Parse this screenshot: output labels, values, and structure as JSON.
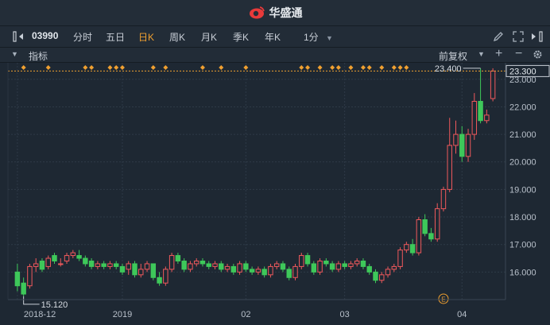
{
  "app": {
    "brand": "华盛通"
  },
  "toolbar": {
    "code": "03990",
    "periods": [
      {
        "label": "分时",
        "active": false
      },
      {
        "label": "五日",
        "active": false
      },
      {
        "label": "日K",
        "active": true
      },
      {
        "label": "周K",
        "active": false
      },
      {
        "label": "月K",
        "active": false
      },
      {
        "label": "季K",
        "active": false
      },
      {
        "label": "年K",
        "active": false
      }
    ],
    "minute": "1分"
  },
  "indicator_bar": {
    "label": "指标",
    "adjust": "前复权"
  },
  "colors": {
    "up": "#f0595c",
    "down": "#3ec85a",
    "accent": "#f0a030",
    "grid": "#2e3a47"
  },
  "chart_data": {
    "type": "candlestick",
    "yticks": [
      "23.000",
      "22.000",
      "21.000",
      "20.000",
      "19.000",
      "18.000",
      "17.000",
      "16.000"
    ],
    "ylim": [
      15.0,
      23.6
    ],
    "xticks": [
      {
        "label": "2018-12",
        "i": 0
      },
      {
        "label": "2019",
        "i": 17
      },
      {
        "label": "02",
        "i": 37
      },
      {
        "label": "03",
        "i": 53
      },
      {
        "label": "04",
        "i": 72
      }
    ],
    "current_price": "23.300",
    "high_label": "23.400",
    "low_label": "15.120",
    "event_marker": "E",
    "event_index": 69,
    "high_index": 75,
    "low_index": 1,
    "dividend_markers": [
      1,
      5,
      11,
      12,
      15,
      16,
      17,
      22,
      24,
      30,
      33,
      37,
      46,
      47,
      49,
      51,
      52,
      54,
      56,
      57,
      59,
      61,
      62,
      63
    ],
    "candles": [
      [
        16.0,
        15.5,
        16.3,
        15.3
      ],
      [
        15.6,
        15.2,
        15.8,
        15.12
      ],
      [
        15.5,
        16.2,
        16.3,
        15.4
      ],
      [
        16.2,
        16.3,
        16.5,
        16.0
      ],
      [
        16.4,
        16.1,
        16.5,
        16.0
      ],
      [
        16.2,
        16.5,
        16.6,
        16.1
      ],
      [
        16.6,
        16.4,
        16.7,
        16.3
      ],
      [
        16.3,
        16.3,
        16.5,
        16.2
      ],
      [
        16.4,
        16.6,
        16.7,
        16.3
      ],
      [
        16.6,
        16.7,
        16.8,
        16.5
      ],
      [
        16.6,
        16.5,
        16.8,
        16.4
      ],
      [
        16.5,
        16.3,
        16.6,
        16.2
      ],
      [
        16.4,
        16.2,
        16.5,
        16.1
      ],
      [
        16.2,
        16.3,
        16.4,
        16.1
      ],
      [
        16.3,
        16.2,
        16.4,
        16.1
      ],
      [
        16.2,
        16.3,
        16.4,
        16.1
      ],
      [
        16.3,
        16.2,
        16.4,
        16.1
      ],
      [
        16.2,
        16.0,
        16.3,
        15.9
      ],
      [
        16.1,
        16.3,
        16.4,
        15.9
      ],
      [
        16.3,
        15.9,
        16.4,
        15.8
      ],
      [
        15.9,
        16.1,
        16.3,
        15.8
      ],
      [
        16.1,
        16.3,
        16.4,
        16.0
      ],
      [
        16.3,
        15.8,
        16.3,
        15.7
      ],
      [
        15.8,
        15.6,
        16.0,
        15.5
      ],
      [
        15.6,
        16.1,
        16.2,
        15.5
      ],
      [
        16.1,
        16.6,
        16.7,
        16.0
      ],
      [
        16.6,
        16.4,
        16.7,
        16.3
      ],
      [
        16.4,
        16.1,
        16.5,
        16.0
      ],
      [
        16.1,
        16.3,
        16.4,
        16.0
      ],
      [
        16.3,
        16.4,
        16.5,
        16.2
      ],
      [
        16.4,
        16.3,
        16.5,
        16.2
      ],
      [
        16.3,
        16.2,
        16.4,
        16.1
      ],
      [
        16.2,
        16.3,
        16.4,
        16.1
      ],
      [
        16.3,
        16.1,
        16.4,
        16.0
      ],
      [
        16.1,
        16.2,
        16.3,
        16.0
      ],
      [
        16.2,
        16.0,
        16.3,
        15.9
      ],
      [
        16.0,
        16.3,
        16.4,
        15.9
      ],
      [
        16.3,
        16.1,
        16.4,
        16.0
      ],
      [
        16.1,
        16.0,
        16.2,
        15.9
      ],
      [
        16.0,
        16.1,
        16.2,
        15.9
      ],
      [
        16.1,
        15.9,
        16.2,
        15.8
      ],
      [
        15.9,
        16.2,
        16.3,
        15.8
      ],
      [
        16.2,
        16.3,
        16.4,
        16.1
      ],
      [
        16.3,
        16.1,
        16.4,
        16.0
      ],
      [
        16.1,
        15.8,
        16.2,
        15.7
      ],
      [
        15.8,
        16.2,
        16.3,
        15.7
      ],
      [
        16.2,
        16.6,
        16.7,
        16.1
      ],
      [
        16.6,
        16.3,
        16.7,
        16.2
      ],
      [
        16.3,
        16.0,
        16.4,
        15.9
      ],
      [
        16.0,
        16.4,
        16.5,
        15.9
      ],
      [
        16.4,
        16.3,
        16.5,
        16.2
      ],
      [
        16.3,
        16.1,
        16.4,
        16.0
      ],
      [
        16.1,
        16.3,
        16.4,
        16.0
      ],
      [
        16.3,
        16.2,
        16.4,
        16.1
      ],
      [
        16.2,
        16.3,
        16.4,
        16.1
      ],
      [
        16.3,
        16.4,
        16.5,
        16.2
      ],
      [
        16.4,
        16.2,
        16.5,
        16.1
      ],
      [
        16.2,
        16.0,
        16.3,
        15.9
      ],
      [
        16.0,
        15.7,
        16.1,
        15.6
      ],
      [
        15.7,
        15.9,
        16.0,
        15.6
      ],
      [
        15.9,
        16.1,
        16.2,
        15.8
      ],
      [
        16.1,
        16.2,
        16.3,
        16.0
      ],
      [
        16.2,
        16.8,
        16.9,
        16.1
      ],
      [
        16.8,
        17.0,
        17.1,
        16.7
      ],
      [
        17.0,
        16.7,
        17.2,
        16.6
      ],
      [
        16.7,
        17.9,
        18.0,
        16.6
      ],
      [
        17.9,
        17.4,
        18.1,
        17.3
      ],
      [
        17.4,
        17.2,
        17.6,
        17.1
      ],
      [
        17.2,
        18.3,
        18.5,
        17.1
      ],
      [
        18.3,
        19.0,
        19.1,
        18.2
      ],
      [
        19.0,
        20.6,
        21.6,
        18.9
      ],
      [
        20.6,
        21.0,
        21.5,
        20.3
      ],
      [
        21.0,
        20.2,
        21.3,
        20.0
      ],
      [
        20.2,
        21.0,
        21.2,
        20.0
      ],
      [
        21.0,
        22.2,
        22.5,
        20.8
      ],
      [
        22.2,
        21.5,
        23.4,
        21.4
      ],
      [
        21.5,
        21.7,
        21.9,
        21.4
      ],
      [
        22.3,
        23.3,
        23.4,
        22.2
      ]
    ]
  }
}
